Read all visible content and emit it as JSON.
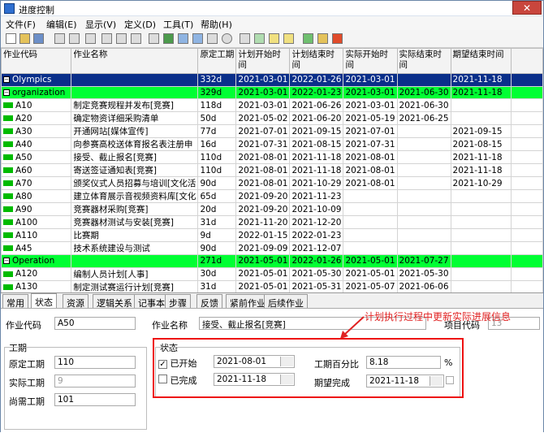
{
  "app": {
    "title": "进度控制",
    "close_glyph": "✕"
  },
  "menu": [
    "文件(F)",
    "编辑(E)",
    "显示(V)",
    "定义(D)",
    "工具(T)",
    "帮助(H)"
  ],
  "columns": [
    "作业代码",
    "作业名称",
    "原定工期",
    "计划开始时间",
    "计划结束时间",
    "实际开始时间",
    "实际结束时间",
    "期望结束时间"
  ],
  "rows": [
    {
      "type": "top",
      "code": "Olympics",
      "name": "",
      "orig": "332d",
      "ps": "2021-03-01",
      "pe": "2022-01-26",
      "as": "2021-03-01",
      "ae": "",
      "exp": "2021-11-18"
    },
    {
      "type": "green",
      "code": "organization",
      "name": "",
      "orig": "329d",
      "ps": "2021-03-01",
      "pe": "2022-01-23",
      "as": "2021-03-01",
      "ae": "2021-06-30",
      "exp": "2021-11-18"
    },
    {
      "type": "task",
      "code": "A10",
      "name": "制定竞赛规程并发布[竞赛]",
      "orig": "118d",
      "ps": "2021-03-01",
      "pe": "2021-06-26",
      "as": "2021-03-01",
      "ae": "2021-06-30",
      "exp": ""
    },
    {
      "type": "task",
      "code": "A20",
      "name": "确定物资详细采购清单",
      "orig": "50d",
      "ps": "2021-05-02",
      "pe": "2021-06-20",
      "as": "2021-05-19",
      "ae": "2021-06-25",
      "exp": ""
    },
    {
      "type": "task",
      "code": "A30",
      "name": "开通网站[媒体宣传]",
      "orig": "77d",
      "ps": "2021-07-01",
      "pe": "2021-09-15",
      "as": "2021-07-01",
      "ae": "",
      "exp": "2021-09-15"
    },
    {
      "type": "task",
      "code": "A40",
      "name": "向参赛高校送体育报名表注册申",
      "orig": "16d",
      "ps": "2021-07-31",
      "pe": "2021-08-15",
      "as": "2021-07-31",
      "ae": "",
      "exp": "2021-08-15"
    },
    {
      "type": "task",
      "code": "A50",
      "name": "接受、截止报名[竞赛]",
      "orig": "110d",
      "ps": "2021-08-01",
      "pe": "2021-11-18",
      "as": "2021-08-01",
      "ae": "",
      "exp": "2021-11-18"
    },
    {
      "type": "task",
      "code": "A60",
      "name": "寄送签证通知表[竞赛]",
      "orig": "110d",
      "ps": "2021-08-01",
      "pe": "2021-11-18",
      "as": "2021-08-01",
      "ae": "",
      "exp": "2021-11-18"
    },
    {
      "type": "task",
      "code": "A70",
      "name": "颁奖仪式人员招募与培训[文化活",
      "orig": "90d",
      "ps": "2021-08-01",
      "pe": "2021-10-29",
      "as": "2021-08-01",
      "ae": "",
      "exp": "2021-10-29"
    },
    {
      "type": "task",
      "code": "A80",
      "name": "建立体育展示音视频资料库[文化",
      "orig": "65d",
      "ps": "2021-09-20",
      "pe": "2021-11-23",
      "as": "",
      "ae": "",
      "exp": ""
    },
    {
      "type": "task",
      "code": "A90",
      "name": "竞赛器材采购[竞赛]",
      "orig": "20d",
      "ps": "2021-09-20",
      "pe": "2021-10-09",
      "as": "",
      "ae": "",
      "exp": ""
    },
    {
      "type": "task",
      "code": "A100",
      "name": "竞赛器材测试与安装[竞赛]",
      "orig": "31d",
      "ps": "2021-11-20",
      "pe": "2021-12-20",
      "as": "",
      "ae": "",
      "exp": ""
    },
    {
      "type": "task",
      "code": "A110",
      "name": "比赛期",
      "orig": "9d",
      "ps": "2022-01-15",
      "pe": "2022-01-23",
      "as": "",
      "ae": "",
      "exp": ""
    },
    {
      "type": "task",
      "code": "A45",
      "name": "技术系统建设与测试",
      "orig": "90d",
      "ps": "2021-09-09",
      "pe": "2021-12-07",
      "as": "",
      "ae": "",
      "exp": ""
    },
    {
      "type": "green",
      "code": "Operation",
      "name": "",
      "orig": "271d",
      "ps": "2021-05-01",
      "pe": "2022-01-26",
      "as": "2021-05-01",
      "ae": "2021-07-27",
      "exp": ""
    },
    {
      "type": "task",
      "code": "A120",
      "name": "编制人员计划[人事]",
      "orig": "30d",
      "ps": "2021-05-01",
      "pe": "2021-05-30",
      "as": "2021-05-01",
      "ae": "2021-05-30",
      "exp": ""
    },
    {
      "type": "task",
      "code": "A130",
      "name": "制定测试赛运行计划[竞赛]",
      "orig": "31d",
      "ps": "2021-05-01",
      "pe": "2021-05-31",
      "as": "2021-05-07",
      "ae": "2021-06-06",
      "exp": ""
    }
  ],
  "tabs": [
    "常用",
    "状态",
    "资源",
    "逻辑关系",
    "记事本",
    "步骤",
    "反馈",
    "紧前作业",
    "后续作业"
  ],
  "detail": {
    "code_label": "作业代码",
    "code_value": "A50",
    "name_label": "作业名称",
    "name_value": "接受、截止报名[竞赛]",
    "project_label": "项目代码",
    "project_value": "13",
    "duration_title": "工期",
    "orig_label": "原定工期",
    "orig_value": "110",
    "actual_label": "实际工期",
    "actual_value": "9",
    "remain_label": "尚需工期",
    "remain_value": "101",
    "status_title": "状态",
    "started_label": "已开始",
    "started_date": "2021-08-01",
    "finished_label": "已完成",
    "finished_date": "2021-11-18",
    "pct_label": "工期百分比",
    "pct_value": "8.18",
    "pct_unit": "%",
    "expect_label": "期望完成",
    "expect_value": "2021-11-18"
  },
  "annotation": "计划执行过程中更新实际进展信息"
}
